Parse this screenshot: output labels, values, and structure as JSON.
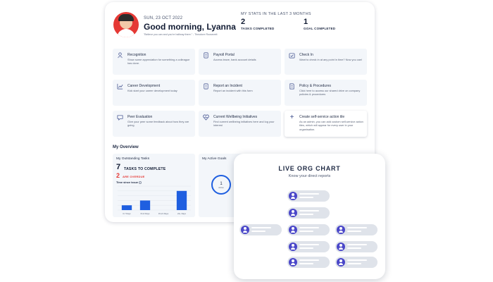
{
  "header": {
    "date": "SUN, 23 OCT 2022",
    "greeting": "Good morning, Lyanna",
    "quote": "\"Believe you can and you're halfway there.\" - Theodore Roosevelt"
  },
  "stats": {
    "title": "MY STATS IN THE LAST 3 MONTHS",
    "items": [
      {
        "value": "2",
        "label": "TASKS COMPLETED"
      },
      {
        "value": "1",
        "label": "GOAL COMPLETED"
      }
    ]
  },
  "tiles": [
    {
      "title": "Recognition",
      "desc": "Show some appreciation for something a colleague has done.",
      "icon": "recognition-icon"
    },
    {
      "title": "Payroll Portal",
      "desc": "Access leave, bank account details",
      "icon": "document-icon"
    },
    {
      "title": "Check In",
      "desc": "Want to check in at any point in time? Now you can!",
      "icon": "check-in-icon"
    },
    {
      "title": "Career Development",
      "desc": "Kick start your career development today",
      "icon": "growth-chart-icon"
    },
    {
      "title": "Report an Incident",
      "desc": "Report an incident with this form",
      "icon": "report-icon"
    },
    {
      "title": "Policy & Procedures",
      "desc": "Click here to access our shared drive on company policies & procedures",
      "icon": "policy-icon"
    },
    {
      "title": "Peer Evaluation",
      "desc": "Give your peer some feedback about how they are going",
      "icon": "feedback-icon"
    },
    {
      "title": "Current Wellbeing Initiatives",
      "desc": "Find current wellbeing initiatives here and log your interest",
      "icon": "heart-pulse-icon"
    },
    {
      "title": "Create self-service action tile",
      "desc": "As an admin, you can add custom self-service action tiles, which will appear for every user in your organisation.",
      "icon": "plus-icon"
    }
  ],
  "overview": {
    "title": "My Overview",
    "tasks": {
      "title": "My Outstanding Tasks",
      "count": "7",
      "count_label": "TASKS TO COMPLETE",
      "overdue": "2",
      "overdue_label": "ARE OVERDUE",
      "time_label": "Time since issue"
    },
    "goals": {
      "title": "My Active Goals",
      "count": "1",
      "label": "Active"
    }
  },
  "chart_data": {
    "type": "bar",
    "categories": [
      "0-7 Days",
      "8-14 Days",
      "15-21 Days",
      "22+ Days"
    ],
    "values": [
      1,
      2,
      0,
      4
    ],
    "ylim": [
      0,
      5
    ],
    "bar_color": "#1f5fe0",
    "grid": true
  },
  "org_chart": {
    "title": "LIVE ORG CHART",
    "subtitle": "Know your direct reports"
  },
  "colors": {
    "accent": "#4a47c9",
    "alert": "#e53935",
    "bar": "#1f5fe0"
  }
}
